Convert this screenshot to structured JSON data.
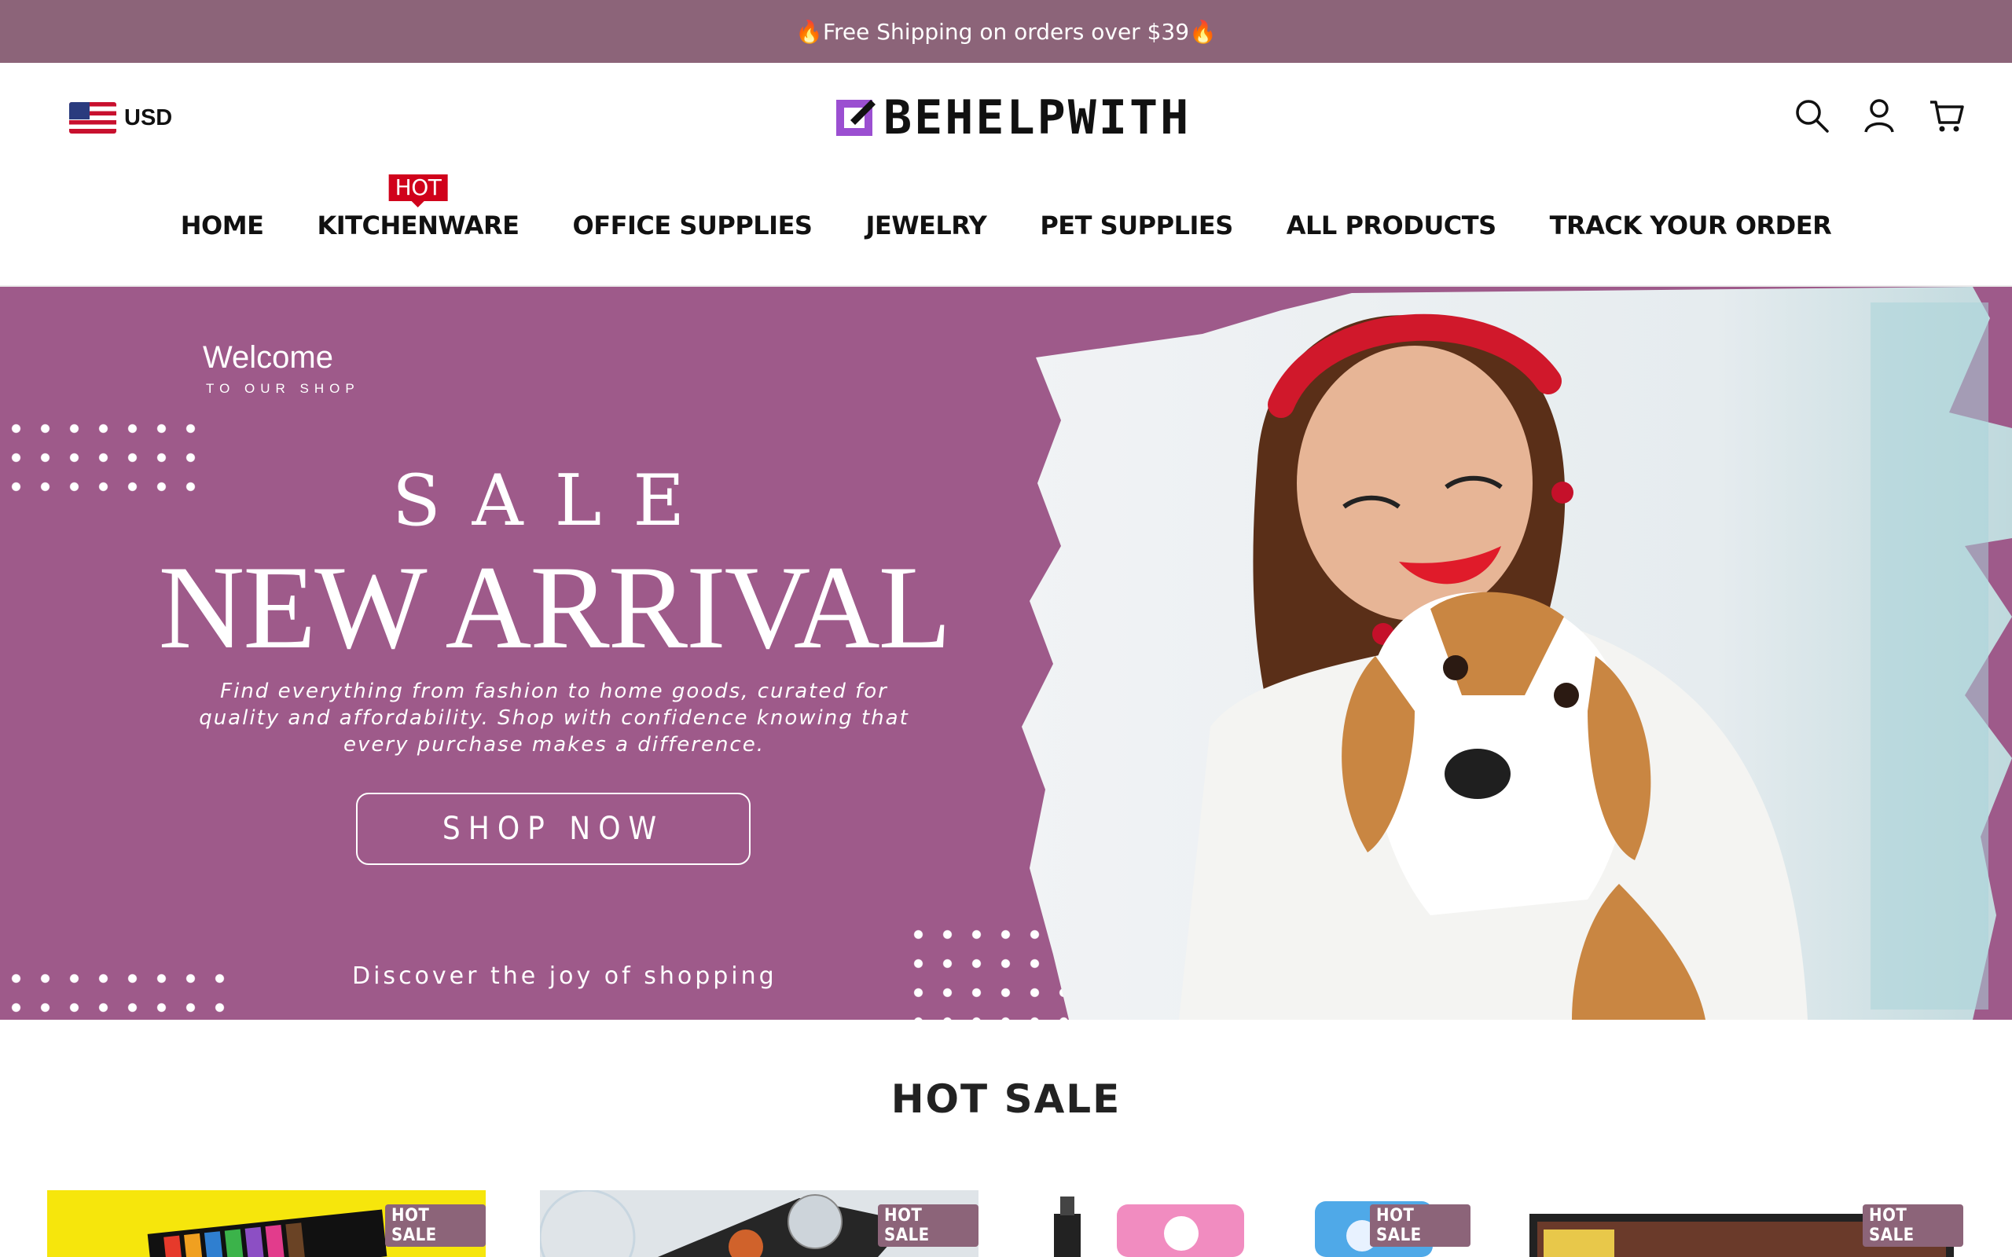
{
  "announcement": {
    "text": "🔥Free Shipping on orders over $39🔥"
  },
  "header": {
    "currency": {
      "code": "USD",
      "flag": "us-flag-icon"
    },
    "logo": {
      "text": "BEHELPWITH",
      "accent": "#9b4fd1"
    },
    "icons": [
      "search-icon",
      "account-icon",
      "cart-icon"
    ]
  },
  "nav": {
    "items": [
      {
        "label": "HOME"
      },
      {
        "label": "KITCHENWARE",
        "badge": "HOT"
      },
      {
        "label": "OFFICE SUPPLIES"
      },
      {
        "label": "JEWELRY"
      },
      {
        "label": "PET SUPPLIES"
      },
      {
        "label": "ALL PRODUCTS"
      },
      {
        "label": "TRACK YOUR ORDER"
      }
    ]
  },
  "hero": {
    "welcome": "Welcome",
    "welcome_sub": "TO OUR SHOP",
    "sale": "SALE",
    "headline": "NEW ARRIVAL",
    "description": "Find everything from fashion to home goods, curated for quality and affordability. Shop with confidence knowing that every purchase makes a difference.",
    "cta": "SHOP NOW",
    "tagline": "Discover the joy of shopping",
    "background": "#9e5a8a"
  },
  "hot_sale": {
    "title": "HOT SALE",
    "cards": [
      {
        "tag": "HOT SALE"
      },
      {
        "tag": "HOT SALE"
      },
      {
        "tag": "HOT SALE"
      },
      {
        "tag": "HOT SALE"
      }
    ]
  },
  "colors": {
    "announcement_bg": "#8c6479",
    "hot_badge": "#d0021b"
  }
}
